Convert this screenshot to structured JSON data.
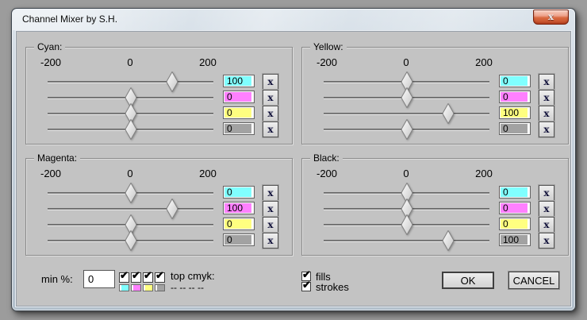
{
  "window": {
    "title": "Channel Mixer by S.H."
  },
  "glyphs": {
    "close": "x",
    "clear": "x",
    "check": "✔"
  },
  "scale": {
    "min": "-200",
    "mid": "0",
    "max": "200"
  },
  "colors": {
    "cyan": "#80ffff",
    "magenta": "#ff80ff",
    "yellow": "#ffff80",
    "black": "#a2a2a2"
  },
  "groups": [
    {
      "label": "Cyan:",
      "rows": [
        {
          "channel": "cyan",
          "value": "100",
          "slider": 100
        },
        {
          "channel": "magenta",
          "value": "0",
          "slider": 0
        },
        {
          "channel": "yellow",
          "value": "0",
          "slider": 0
        },
        {
          "channel": "black",
          "value": "0",
          "slider": 0
        }
      ]
    },
    {
      "label": "Yellow:",
      "rows": [
        {
          "channel": "cyan",
          "value": "0",
          "slider": 0
        },
        {
          "channel": "magenta",
          "value": "0",
          "slider": 0
        },
        {
          "channel": "yellow",
          "value": "100",
          "slider": 100
        },
        {
          "channel": "black",
          "value": "0",
          "slider": 0
        }
      ]
    },
    {
      "label": "Magenta:",
      "rows": [
        {
          "channel": "cyan",
          "value": "0",
          "slider": 0
        },
        {
          "channel": "magenta",
          "value": "100",
          "slider": 100
        },
        {
          "channel": "yellow",
          "value": "0",
          "slider": 0
        },
        {
          "channel": "black",
          "value": "0",
          "slider": 0
        }
      ]
    },
    {
      "label": "Black:",
      "rows": [
        {
          "channel": "cyan",
          "value": "0",
          "slider": 0
        },
        {
          "channel": "magenta",
          "value": "0",
          "slider": 0
        },
        {
          "channel": "yellow",
          "value": "0",
          "slider": 0
        },
        {
          "channel": "black",
          "value": "100",
          "slider": 100
        }
      ]
    }
  ],
  "footer": {
    "min_label": "min %:",
    "min_value": "0",
    "channel_toggles": [
      {
        "channel": "cyan",
        "checked": true
      },
      {
        "channel": "magenta",
        "checked": true
      },
      {
        "channel": "yellow",
        "checked": true
      },
      {
        "channel": "black",
        "checked": true
      }
    ],
    "top_cmyk_label": "top cmyk:",
    "top_cmyk_value": "-- -- -- --",
    "fills_label": "fills",
    "fills_checked": true,
    "strokes_label": "strokes",
    "strokes_checked": true,
    "ok_label": "OK",
    "cancel_label": "CANCEL"
  }
}
